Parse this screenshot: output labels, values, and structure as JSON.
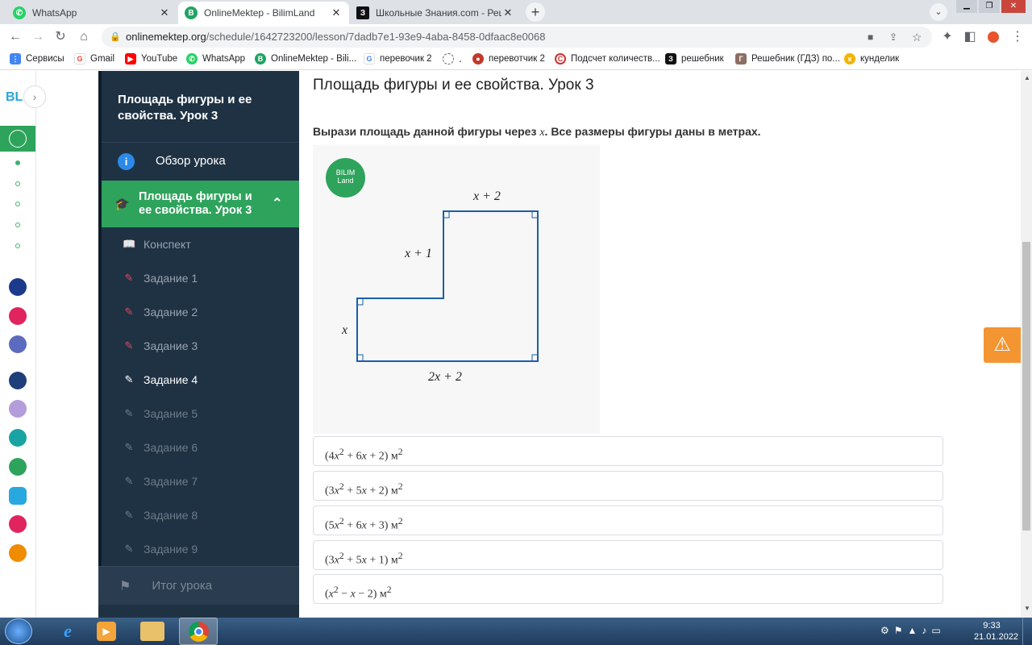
{
  "browser": {
    "tabs": [
      {
        "title": "WhatsApp",
        "icon": "whatsapp-icon",
        "color": "#25d366"
      },
      {
        "title": "OnlineMektep - BilimLand",
        "icon": "bilimland-icon",
        "color": "#1fa463"
      },
      {
        "title": "Школьные Знания.com - Решае",
        "icon": "znanija-icon",
        "color": "#111111"
      }
    ],
    "url_host": "onlinemektep.org",
    "url_path": "/schedule/1642723200/lesson/7dadb7e1-93e9-4aba-8458-0dfaac8e0068",
    "bookmarks": [
      {
        "label": "Сервисы",
        "color": "#4285f4"
      },
      {
        "label": "Gmail",
        "color": "#ea4335"
      },
      {
        "label": "YouTube",
        "color": "#ff0000"
      },
      {
        "label": "WhatsApp",
        "color": "#25d366"
      },
      {
        "label": "OnlineMektep - Bili...",
        "color": "#1fa463"
      },
      {
        "label": "перевочик 2",
        "color": "#4285f4"
      },
      {
        "label": "․",
        "color": "#666666"
      },
      {
        "label": "перевотчик 2",
        "color": "#c0392b"
      },
      {
        "label": "Подсчет количеств...",
        "color": "#d32f2f"
      },
      {
        "label": "решебник",
        "color": "#111111"
      },
      {
        "label": "Решебник (ГДЗ) по...",
        "color": "#8d6e63"
      },
      {
        "label": "кунделик",
        "color": "#f4b400"
      }
    ]
  },
  "rail": {
    "logo": "BL"
  },
  "sidebar": {
    "lesson_title": "Площадь фигуры и ее свойства. Урок 3",
    "overview": "Обзор урока",
    "active_section": "Площадь фигуры и ее свойства. Урок 3",
    "summary": "Конспект",
    "tasks": [
      "Задание 1",
      "Задание 2",
      "Задание 3",
      "Задание 4",
      "Задание 5",
      "Задание 6",
      "Задание 7",
      "Задание 8",
      "Задание 9"
    ],
    "final": "Итог урока"
  },
  "main": {
    "title": "Площадь фигуры и ее свойства. Урок 3",
    "question_before": "Вырази площадь данной фигуры через ",
    "question_var": "x",
    "question_after": ". Все размеры фигуры даны в метрах.",
    "figure": {
      "badge_line1": "BILIM",
      "badge_line2": "Land",
      "label_top": "x + 2",
      "label_upper_left": "x + 1",
      "label_left": "x",
      "label_bottom": "2x + 2"
    },
    "options": [
      {
        "a": "(4",
        "b": " + 6",
        "c": " + 2) м"
      },
      {
        "a": "(3",
        "b": " + 5",
        "c": " + 2) м"
      },
      {
        "a": "(5",
        "b": " + 6",
        "c": " + 3) м"
      },
      {
        "a": "(3",
        "b": " + 5",
        "c": " + 1) м"
      },
      {
        "a": "(",
        "b": " − ",
        "c": " − 2) м"
      }
    ]
  },
  "taskbar": {
    "time": "9:33",
    "date": "21.01.2022"
  },
  "colors": {
    "sidebar": "#1f3244",
    "active": "#2ea35c",
    "task_accent": "#e0475a",
    "warning": "#f39530"
  }
}
